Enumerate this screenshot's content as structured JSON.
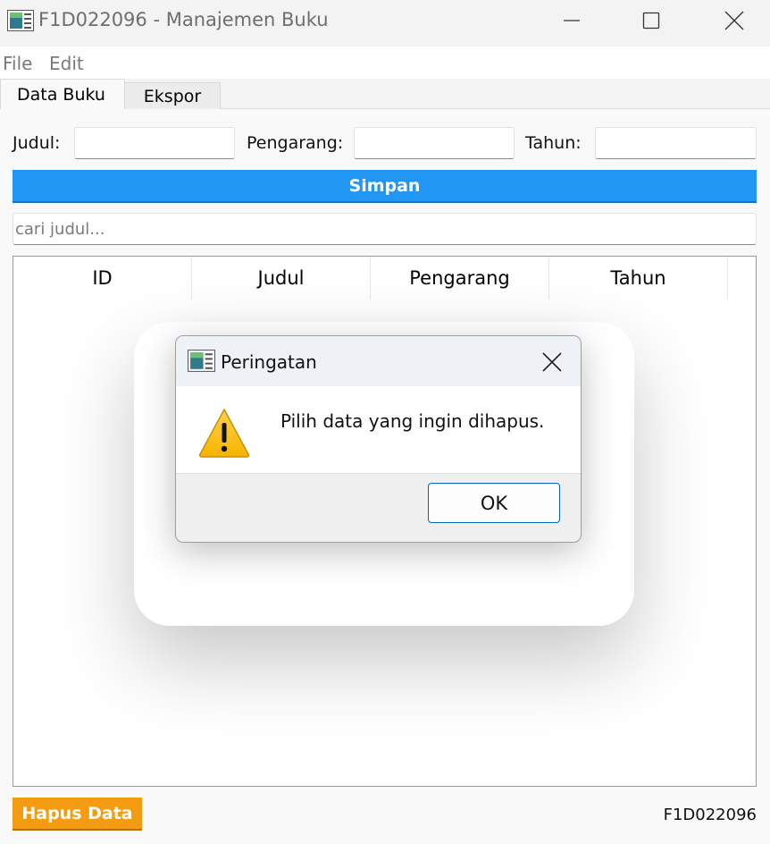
{
  "window": {
    "title": "F1D022096 - Manajemen Buku",
    "controls": [
      "minimize-icon",
      "maximize-icon",
      "close-icon"
    ]
  },
  "menu": {
    "file": "File",
    "edit": "Edit"
  },
  "tabs": {
    "data_buku": "Data Buku",
    "ekspor": "Ekspor",
    "active": "Data Buku"
  },
  "form": {
    "judul_label": "Judul:",
    "judul_value": "",
    "pengarang_label": "Pengarang:",
    "pengarang_value": "",
    "tahun_label": "Tahun:",
    "tahun_value": "",
    "simpan_label": "Simpan"
  },
  "search": {
    "placeholder": "cari judul...",
    "value": ""
  },
  "table": {
    "headers": [
      "ID",
      "Judul",
      "Pengarang",
      "Tahun"
    ],
    "rows": []
  },
  "footer": {
    "hapus_label": "Hapus Data",
    "status_text": "F1D022096"
  },
  "dialog": {
    "title": "Peringatan",
    "icon": "warning-icon",
    "message": "Pilih data yang ingin dihapus.",
    "ok_label": "OK"
  },
  "colors": {
    "simpan": "#2196f3",
    "hapus": "#f39c12",
    "ok_border": "#0067c0"
  }
}
